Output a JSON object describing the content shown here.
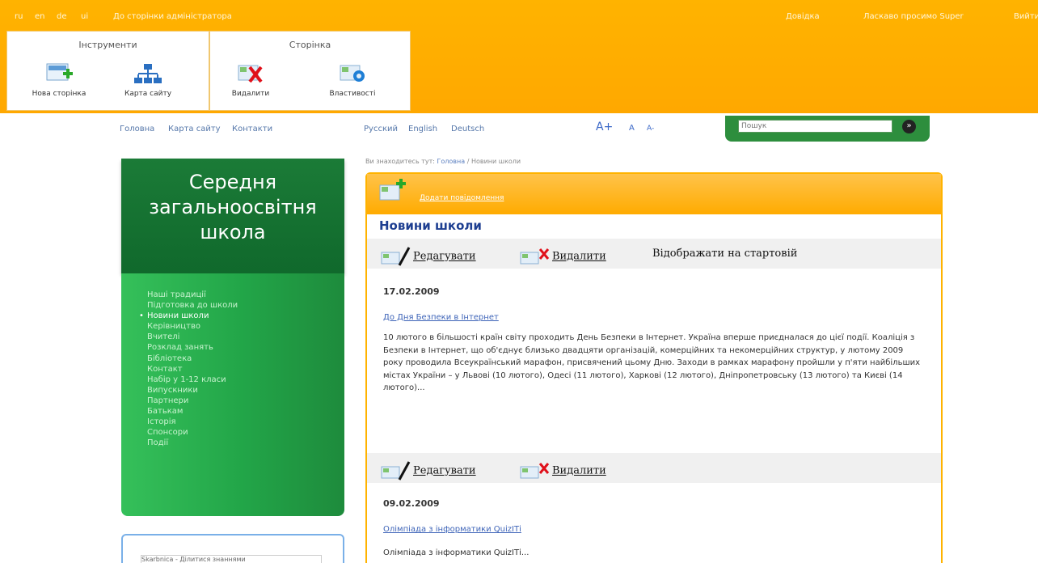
{
  "admin_bar": {
    "langs": [
      "ru",
      "en",
      "de",
      "ui"
    ],
    "admin_link": "До сторінки адміністратора",
    "help": "Довідка",
    "welcome": "Ласкаво просимо Super",
    "logout": "Вийти"
  },
  "toolgroups": {
    "tools": {
      "title": "Інструменти",
      "items": [
        "Нова сторінка",
        "Карта сайту"
      ]
    },
    "page": {
      "title": "Сторінка",
      "items": [
        "Видалити",
        "Властивості"
      ]
    }
  },
  "nav": {
    "links": [
      "Головна",
      "Карта сайту",
      "Контакти"
    ],
    "languages": [
      "Русский",
      "English",
      "Deutsch"
    ],
    "font_sizes": [
      "A+",
      "A",
      "A-"
    ]
  },
  "search": {
    "placeholder": "Пошук",
    "button": "»"
  },
  "sidebar": {
    "title_lines": [
      "Середня",
      "загальноосвітня",
      "школа"
    ],
    "active_bullet": "•",
    "items": [
      "Наші традиції",
      "Підготовка до школи",
      "Новини школи",
      "Керівництво",
      "Вчителі",
      "Розклад занять",
      "Бібліотека",
      "Контакт",
      "Набір у 1-12 класи",
      "Випускники",
      "Партнери",
      "Батькам",
      "Історія",
      "Спонсори",
      "Події"
    ],
    "widget_text": "Skarbnica - Ділитися знаннями"
  },
  "breadcrumb": {
    "prefix": "Ви знаходитесь тут:",
    "home": "Головна",
    "separator": "/",
    "current": "Новини школи"
  },
  "content": {
    "add_message": "Додати повідомлення",
    "section_title": "Новини школи",
    "edit_label": "Редагувати",
    "delete_label": "Видалити",
    "show_on_start": "Відображати на стартовій",
    "news": [
      {
        "date": "17.02.2009",
        "title": "До Дня Безпеки в Інтернет",
        "text": "10 лютого в більшості країн світу проходить День Безпеки в Інтернет. Україна вперше приєдналася до цієї події. Коаліція з Безпеки в Інтернет, що об'єднує близько двадцяти організацій, комерційних та некомерційних структур, у лютому 2009 року проводила Всеукраїнський марафон, присвячений цьому Дню.  Заходи в рамках марафону пройшли у п'яти найбільших містах України – у Львові (10 лютого), Одесі (11 лютого), Харкові (12 лютого), Дніпропетровську (13 лютого) та Києві (14 лютого)..."
      },
      {
        "date": "09.02.2009",
        "title": "Олімпіада з інформатики QuizITі",
        "text": "Олімпіада з інформатики QuizITі..."
      }
    ]
  },
  "colors": {
    "admin_orange": "#ffa800",
    "school_green": "#1b7b37",
    "menu_green": "#22a548",
    "title_blue": "#1e3f91",
    "link_blue": "#3e64b8"
  }
}
